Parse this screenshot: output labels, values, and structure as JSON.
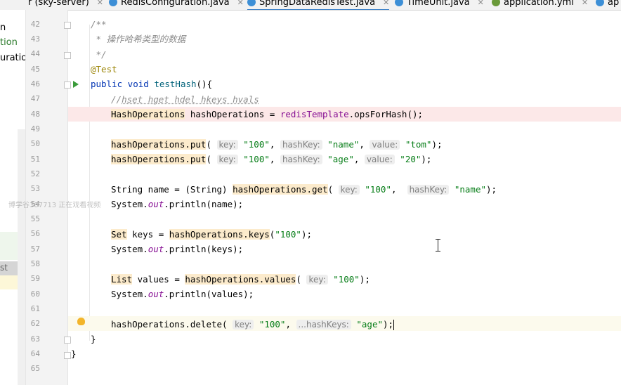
{
  "tabs": [
    {
      "label": "r (sky-server)",
      "icon": "module-icon",
      "active": false
    },
    {
      "label": "RedisConfiguration.java",
      "icon": "java-class-icon",
      "active": false
    },
    {
      "label": "SpringDataRedisTest.java",
      "icon": "java-class-icon",
      "active": true
    },
    {
      "label": "TimeUnit.java",
      "icon": "java-class-icon",
      "active": false
    },
    {
      "label": "application.yml",
      "icon": "yaml-icon",
      "active": false
    },
    {
      "label": "ap",
      "icon": "file-icon",
      "active": false
    }
  ],
  "project_panel": {
    "items": [
      "n",
      "tion",
      "uratio",
      "st"
    ]
  },
  "watermark": "博学谷387713 正在观看视频",
  "line_numbers": [
    "42",
    "43",
    "44",
    "45",
    "46",
    "47",
    "48",
    "49",
    "50",
    "51",
    "52",
    "53",
    "54",
    "55",
    "56",
    "57",
    "58",
    "59",
    "60",
    "61",
    "62",
    "63",
    "64",
    "65"
  ],
  "code": {
    "l42": "/**",
    "l43_star": " * ",
    "l43_text": "操作哈希类型的数据",
    "l44": " */",
    "l45": "@Test",
    "l46_kw": "public void ",
    "l46_fn": "testHash",
    "l46_rest": "(){",
    "l47_a": "//",
    "l47_b": "hset hget hdel hkeys hvals",
    "l48_type": "HashOperations",
    "l48_rest": " hashOperations = ",
    "l48_field": "redisTemplate",
    "l48_call": ".opsForHash();",
    "put": "hashOperations.put",
    "hint_key": "key:",
    "hint_hashkey": "hashKey:",
    "hint_value": "value:",
    "hint_hashkeys": "...hashKeys:",
    "s100": "\"100\"",
    "s_name": "\"name\"",
    "s_tom": "\"tom\"",
    "s_age": "\"age\"",
    "s_20": "\"20\"",
    "l53_a": "String name = (String) ",
    "l53_call": "hashOperations.get",
    "sys_a": "System.",
    "sys_out": "out",
    "l54_b": ".println(name);",
    "l56_type": "Set",
    "l56_a": " keys = ",
    "l56_call": "hashOperations.keys",
    "l56_b": "(",
    "l56_c": ");",
    "l57_b": ".println(keys);",
    "l59_type": "List",
    "l59_a": " values = ",
    "l59_call": "hashOperations.values",
    "l60_b": ".println(values);",
    "l62_call": "hashOperations.delete",
    "l63": "}",
    "l64": "}"
  }
}
